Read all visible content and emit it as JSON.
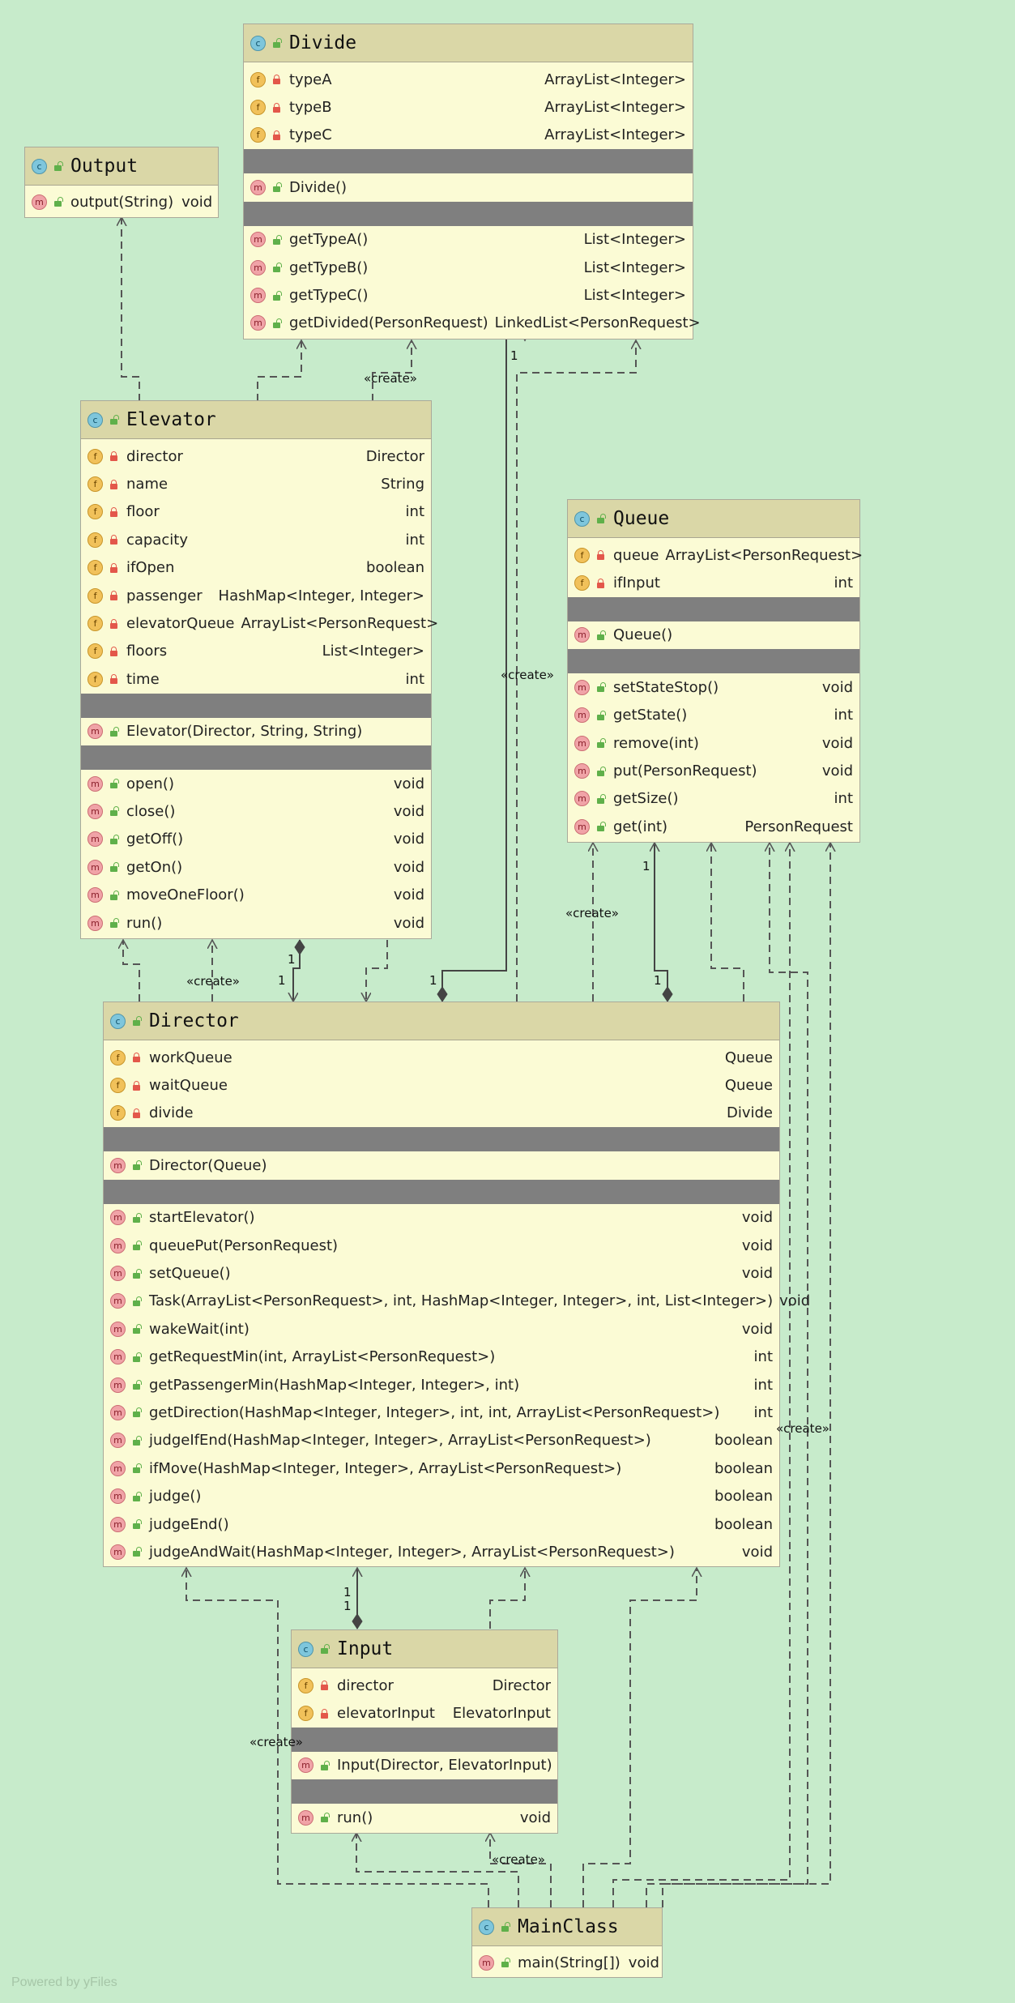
{
  "colors": {
    "background": "#c7ebcb",
    "class_body": "#fbfbd5",
    "class_header": "#dad7a7",
    "separator": "#7f7f7f",
    "edge": "#555555"
  },
  "classes": {
    "divide": {
      "name": "Divide",
      "fields": [
        {
          "name": "typeA",
          "type": "ArrayList<Integer>"
        },
        {
          "name": "typeB",
          "type": "ArrayList<Integer>"
        },
        {
          "name": "typeC",
          "type": "ArrayList<Integer>"
        }
      ],
      "constructors": [
        {
          "name": "Divide()",
          "type": ""
        }
      ],
      "methods": [
        {
          "name": "getTypeA()",
          "type": "List<Integer>"
        },
        {
          "name": "getTypeB()",
          "type": "List<Integer>"
        },
        {
          "name": "getTypeC()",
          "type": "List<Integer>"
        },
        {
          "name": "getDivided(PersonRequest)",
          "type": "LinkedList<PersonRequest>"
        }
      ]
    },
    "output": {
      "name": "Output",
      "methods": [
        {
          "name": "output(String)",
          "type": "void"
        }
      ]
    },
    "elevator": {
      "name": "Elevator",
      "fields": [
        {
          "name": "director",
          "type": "Director"
        },
        {
          "name": "name",
          "type": "String"
        },
        {
          "name": "floor",
          "type": "int"
        },
        {
          "name": "capacity",
          "type": "int"
        },
        {
          "name": "ifOpen",
          "type": "boolean"
        },
        {
          "name": "passenger",
          "type": "HashMap<Integer, Integer>"
        },
        {
          "name": "elevatorQueue",
          "type": "ArrayList<PersonRequest>"
        },
        {
          "name": "floors",
          "type": "List<Integer>"
        },
        {
          "name": "time",
          "type": "int"
        }
      ],
      "constructors": [
        {
          "name": "Elevator(Director, String, String)",
          "type": ""
        }
      ],
      "methods": [
        {
          "name": "open()",
          "type": "void"
        },
        {
          "name": "close()",
          "type": "void"
        },
        {
          "name": "getOff()",
          "type": "void"
        },
        {
          "name": "getOn()",
          "type": "void"
        },
        {
          "name": "moveOneFloor()",
          "type": "void"
        },
        {
          "name": "run()",
          "type": "void"
        }
      ]
    },
    "queue": {
      "name": "Queue",
      "fields": [
        {
          "name": "queue",
          "type": "ArrayList<PersonRequest>"
        },
        {
          "name": "ifInput",
          "type": "int"
        }
      ],
      "constructors": [
        {
          "name": "Queue()",
          "type": ""
        }
      ],
      "methods": [
        {
          "name": "setStateStop()",
          "type": "void"
        },
        {
          "name": "getState()",
          "type": "int"
        },
        {
          "name": "remove(int)",
          "type": "void"
        },
        {
          "name": "put(PersonRequest)",
          "type": "void"
        },
        {
          "name": "getSize()",
          "type": "int"
        },
        {
          "name": "get(int)",
          "type": "PersonRequest"
        }
      ]
    },
    "director": {
      "name": "Director",
      "fields": [
        {
          "name": "workQueue",
          "type": "Queue"
        },
        {
          "name": "waitQueue",
          "type": "Queue"
        },
        {
          "name": "divide",
          "type": "Divide"
        }
      ],
      "constructors": [
        {
          "name": "Director(Queue)",
          "type": ""
        }
      ],
      "methods": [
        {
          "name": "startElevator()",
          "type": "void"
        },
        {
          "name": "queuePut(PersonRequest)",
          "type": "void"
        },
        {
          "name": "setQueue()",
          "type": "void"
        },
        {
          "name": "Task(ArrayList<PersonRequest>, int, HashMap<Integer, Integer>, int, List<Integer>)",
          "type": "void"
        },
        {
          "name": "wakeWait(int)",
          "type": "void"
        },
        {
          "name": "getRequestMin(int, ArrayList<PersonRequest>)",
          "type": "int"
        },
        {
          "name": "getPassengerMin(HashMap<Integer, Integer>, int)",
          "type": "int"
        },
        {
          "name": "getDirection(HashMap<Integer, Integer>, int, int, ArrayList<PersonRequest>)",
          "type": "int"
        },
        {
          "name": "judgeIfEnd(HashMap<Integer, Integer>, ArrayList<PersonRequest>)",
          "type": "boolean"
        },
        {
          "name": "ifMove(HashMap<Integer, Integer>, ArrayList<PersonRequest>)",
          "type": "boolean"
        },
        {
          "name": "judge()",
          "type": "boolean"
        },
        {
          "name": "judgeEnd()",
          "type": "boolean"
        },
        {
          "name": "judgeAndWait(HashMap<Integer, Integer>, ArrayList<PersonRequest>)",
          "type": "void"
        }
      ]
    },
    "input": {
      "name": "Input",
      "fields": [
        {
          "name": "director",
          "type": "Director"
        },
        {
          "name": "elevatorInput",
          "type": "ElevatorInput"
        }
      ],
      "constructors": [
        {
          "name": "Input(Director, ElevatorInput)",
          "type": ""
        }
      ],
      "methods": [
        {
          "name": "run()",
          "type": "void"
        }
      ]
    },
    "mainclass": {
      "name": "MainClass",
      "methods": [
        {
          "name": "main(String[])",
          "type": "void"
        }
      ]
    }
  },
  "edge_labels": {
    "create": "«create»",
    "one": "1"
  },
  "watermark": "Powered by yFiles"
}
